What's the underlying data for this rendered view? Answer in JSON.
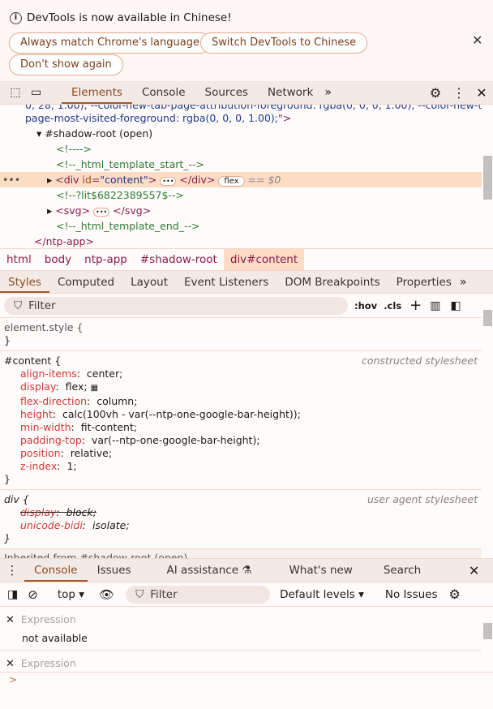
{
  "infobar": {
    "message": "DevTools is now available in Chinese!",
    "buttons": [
      "Always match Chrome's language",
      "Switch DevTools to Chinese",
      "Don't show again"
    ]
  },
  "main_tabs": [
    "Elements",
    "Console",
    "Sources",
    "Network"
  ],
  "dom": {
    "line0": "0, 28, 1.00); --color-new-tab-page-attribution-foreground: rgba(0, 0, 0, 1.00); --color-new-tab-",
    "line1": "page-most-visited-foreground: rgba(0, 0, 0, 1.00);",
    "shadow": "#shadow-root (open)",
    "c1": "<!---->",
    "c2": "<!--_html_template_start_-->",
    "div_open": "<div ",
    "div_attr": "id",
    "div_val": "\"content\"",
    "div_close": "</div>",
    "badge": "flex",
    "eq": "== $0",
    "c3": "<!--?lit$6822389557$-->",
    "svg_open": "<svg>",
    "svg_close": "</svg>",
    "c4": "<!--_html_template_end_-->",
    "end": "</ntp-app>"
  },
  "breadcrumb": [
    "html",
    "body",
    "ntp-app",
    "#shadow-root",
    "div#content"
  ],
  "sidebar_tabs": [
    "Styles",
    "Computed",
    "Layout",
    "Event Listeners",
    "DOM Breakpoints",
    "Properties"
  ],
  "styles_filter": {
    "placeholder": "Filter",
    "hov": ":hov",
    "cls": ".cls"
  },
  "rules": {
    "element": "element.style {",
    "content_sel": "#content {",
    "content_src": "constructed stylesheet",
    "props": [
      [
        "align-items",
        "center;"
      ],
      [
        "display",
        "flex;"
      ],
      [
        "flex-direction",
        "column;"
      ],
      [
        "height",
        "calc(100vh - var(--ntp-one-google-bar-height));"
      ],
      [
        "min-width",
        "fit-content;"
      ],
      [
        "padding-top",
        "var(--ntp-one-google-bar-height);"
      ],
      [
        "position",
        "relative;"
      ],
      [
        "z-index",
        "1;"
      ]
    ],
    "div_sel": "div {",
    "div_src": "user agent stylesheet",
    "div_props": [
      [
        "display",
        "block;"
      ],
      [
        "unicode-bidi",
        "isolate;"
      ]
    ],
    "inherited": "Inherited from #shadow-root (open)",
    "close": "}"
  },
  "drawer_tabs": [
    "Console",
    "Issues",
    "AI assistance",
    "What's new",
    "Search"
  ],
  "console_toolbar": {
    "context": "top",
    "filter": "Filter",
    "levels": "Default levels",
    "issues": "No Issues"
  },
  "expressions": [
    {
      "label": "Expression",
      "value": "not available"
    },
    {
      "label": "Expression"
    }
  ],
  "prompt": ">"
}
